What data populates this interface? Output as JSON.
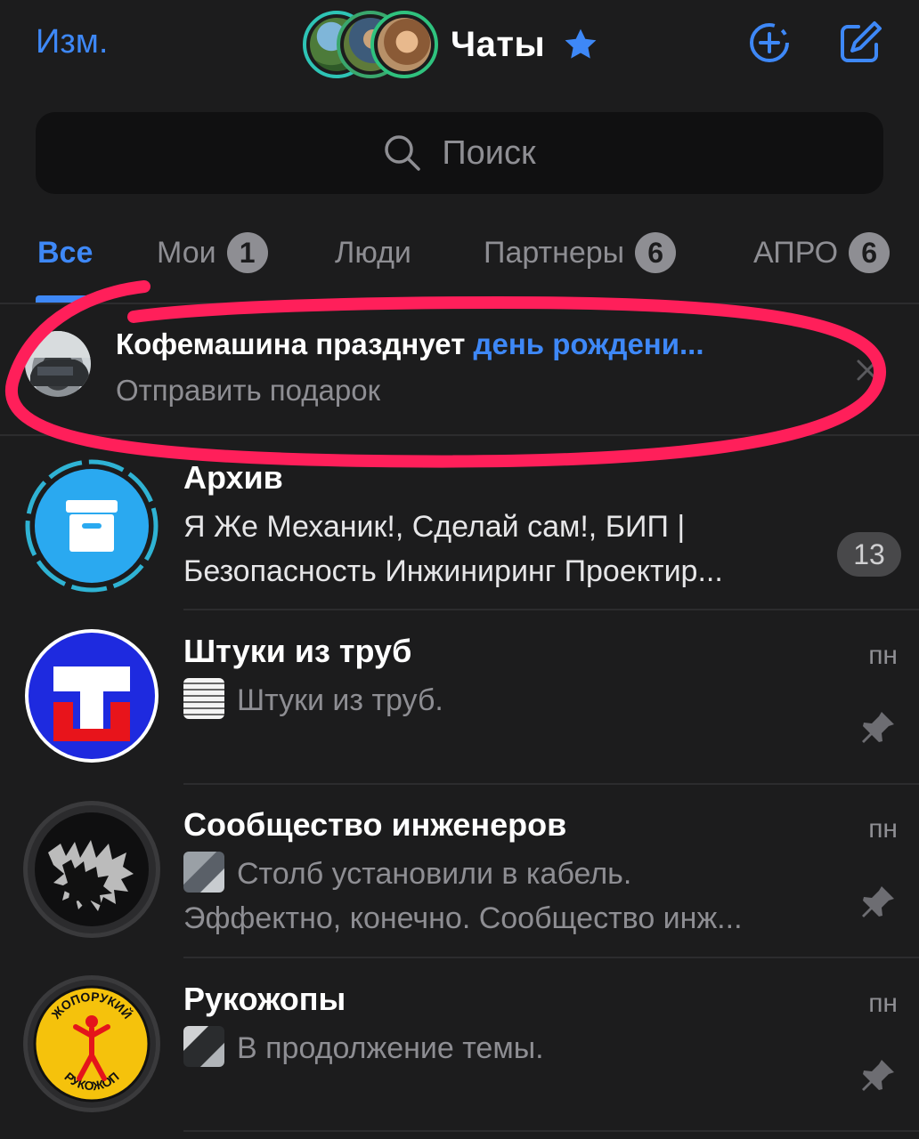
{
  "header": {
    "edit_label": "Изм.",
    "title": "Чаты",
    "icons": [
      "star-icon",
      "add-story-icon",
      "compose-icon"
    ]
  },
  "search": {
    "placeholder": "Поиск"
  },
  "tabs": [
    {
      "label": "Все",
      "badge": "",
      "active": true
    },
    {
      "label": "Мои",
      "badge": "1"
    },
    {
      "label": "Люди",
      "badge": ""
    },
    {
      "label": "Партнеры",
      "badge": "6"
    },
    {
      "label": "АПРО",
      "badge": "6"
    }
  ],
  "birthday": {
    "title_prefix": "Кофемашина празднует ",
    "title_highlight": "день рождени...",
    "subtitle": "Отправить подарок"
  },
  "chats": [
    {
      "name": "Архив",
      "line1": "Я Же Механик!, Сделай сам!, БИП |",
      "line2": "Безопасность Инжиниринг Проектир...",
      "unread": "13"
    },
    {
      "name": "Штуки из труб",
      "line1": "Штуки из труб.",
      "time": "пн",
      "pinned": true
    },
    {
      "name": "Сообщество инженеров",
      "line1": "Столб установили в кабель.",
      "line2": "Эффектно, конечно. Сообщество инж...",
      "time": "пн",
      "pinned": true
    },
    {
      "name": "Рукожопы",
      "line1": "В продолжение темы.",
      "time": "пн",
      "pinned": true,
      "logo_text_top": "ЖОПОРУКИЙ",
      "logo_text_bottom": "РУКОЖОП"
    }
  ],
  "colors": {
    "accent": "#3e88f7",
    "background": "#1c1c1d",
    "annotation": "#ff1f5a"
  }
}
